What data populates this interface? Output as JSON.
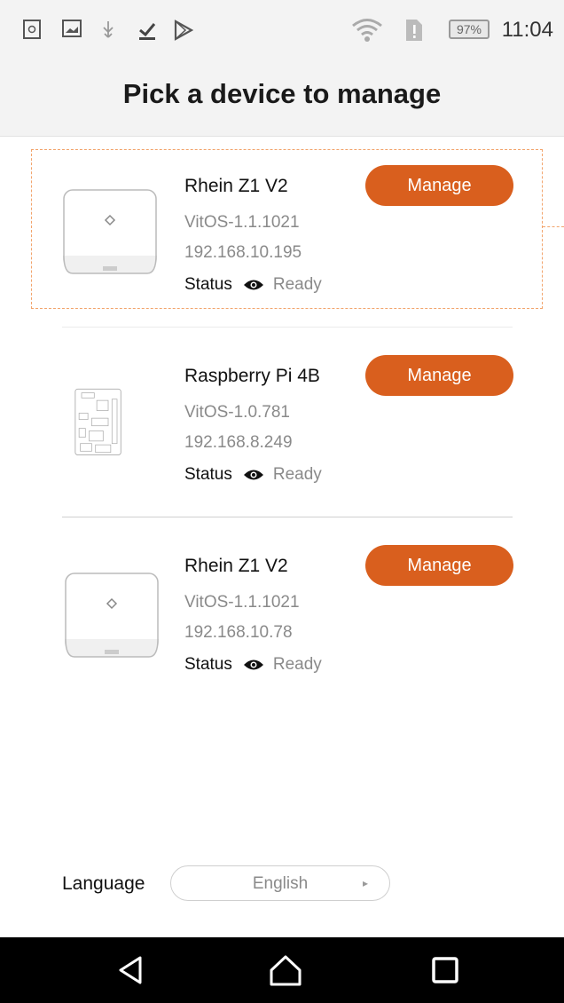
{
  "status_bar": {
    "battery": "97%",
    "time": "11:04",
    "icons": [
      "sim-icon",
      "image-icon",
      "usb-icon",
      "download-done-icon",
      "play-store-icon",
      "wifi-icon",
      "sim-alert-icon",
      "battery-icon"
    ]
  },
  "header": {
    "title": "Pick a device to manage"
  },
  "devices": [
    {
      "name": "Rhein Z1 V2",
      "os": "VitOS-1.1.1021",
      "ip": "192.168.10.195",
      "status_label": "Status",
      "status_value": "Ready",
      "button": "Manage",
      "image": "router-box-icon",
      "selected": true
    },
    {
      "name": "Raspberry Pi 4B",
      "os": "VitOS-1.0.781",
      "ip": "192.168.8.249",
      "status_label": "Status",
      "status_value": "Ready",
      "button": "Manage",
      "image": "circuit-board-icon",
      "selected": false
    },
    {
      "name": "Rhein Z1 V2",
      "os": "VitOS-1.1.1021",
      "ip": "192.168.10.78",
      "status_label": "Status",
      "status_value": "Ready",
      "button": "Manage",
      "image": "router-box-icon",
      "selected": false
    }
  ],
  "language": {
    "label": "Language",
    "value": "English"
  },
  "nav": {
    "buttons": [
      "back-icon",
      "home-icon",
      "recents-icon"
    ]
  },
  "colors": {
    "accent": "#d95f1e",
    "selection": "#f2a46c",
    "muted_text": "#8a8a8a",
    "nav_bg": "#000000"
  }
}
